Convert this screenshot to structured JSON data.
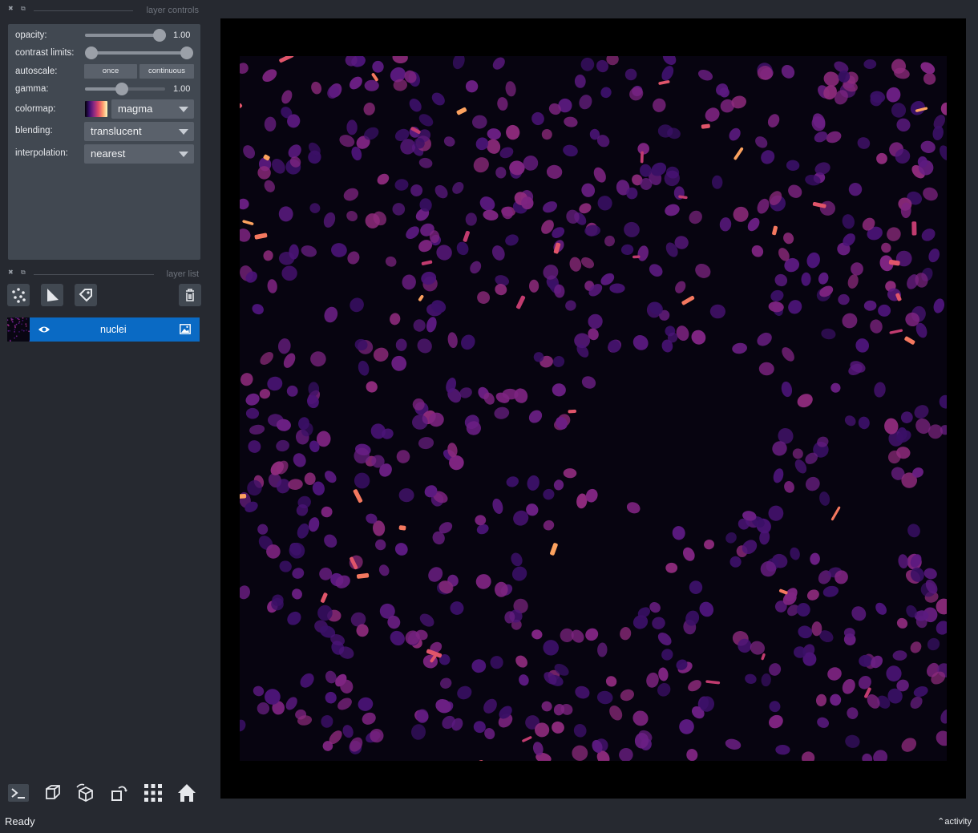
{
  "controls": {
    "dock_title": "layer controls",
    "opacity": {
      "label": "opacity:",
      "value": "1.00",
      "level": 1.0
    },
    "contrast_limits": {
      "label": "contrast limits:",
      "low": 0.0,
      "high": 1.0
    },
    "autoscale": {
      "label": "autoscale:",
      "once": "once",
      "continuous": "continuous"
    },
    "gamma": {
      "label": "gamma:",
      "value": "1.00",
      "level": 0.5
    },
    "colormap": {
      "label": "colormap:",
      "value": "magma"
    },
    "blending": {
      "label": "blending:",
      "value": "translucent"
    },
    "interpolation": {
      "label": "interpolation:",
      "value": "nearest"
    }
  },
  "layer_list": {
    "dock_title": "layer list",
    "tools": [
      "new-points-layer-icon",
      "new-shapes-layer-icon",
      "new-labels-layer-icon",
      "delete-layer-icon"
    ],
    "layers": [
      {
        "name": "nuclei",
        "visible": true,
        "type": "image"
      }
    ]
  },
  "bottom_toolbar": [
    "console-icon",
    "ndisplay-toggle-icon",
    "roll-dims-icon",
    "transpose-dims-icon",
    "grid-view-icon",
    "home-icon"
  ],
  "status": {
    "text": "Ready",
    "activity": "activity"
  },
  "colors": {
    "background": "#262930",
    "panel": "#414851",
    "selected_layer": "#0a6ac4",
    "canvas": "#000000"
  }
}
